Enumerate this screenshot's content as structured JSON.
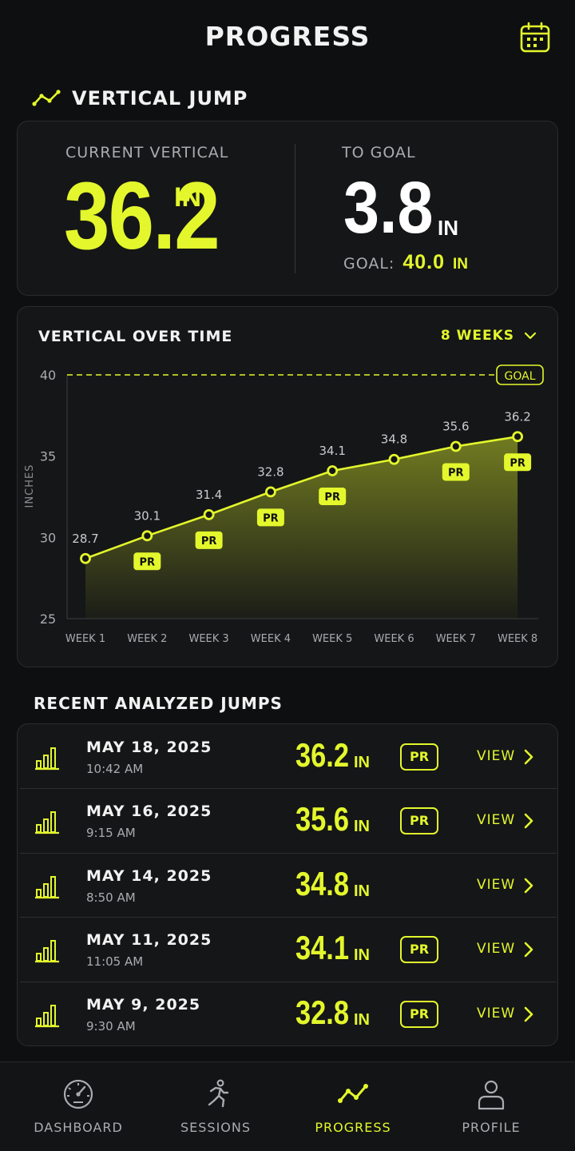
{
  "header": {
    "title": "PROGRESS"
  },
  "section": {
    "title": "VERTICAL JUMP"
  },
  "stats": {
    "current_label": "CURRENT VERTICAL",
    "current_value": "36.2",
    "current_unit": "IN",
    "to_goal_label": "TO GOAL",
    "to_goal_value": "3.8",
    "to_goal_unit": "IN",
    "goal_label": "GOAL:",
    "goal_value": "40.0",
    "goal_unit": "IN"
  },
  "chart": {
    "title": "VERTICAL OVER TIME",
    "range_label": "8 WEEKS",
    "goal_tag": "GOAL",
    "pr_label": "PR"
  },
  "chart_data": {
    "type": "line",
    "x": [
      "WEEK 1",
      "WEEK 2",
      "WEEK 3",
      "WEEK 4",
      "WEEK 5",
      "WEEK 6",
      "WEEK 7",
      "WEEK 8"
    ],
    "series": [
      {
        "values": [
          28.7,
          30.1,
          31.4,
          32.8,
          34.1,
          34.8,
          35.6,
          36.2
        ]
      }
    ],
    "pr_flags": [
      false,
      true,
      true,
      true,
      true,
      false,
      true,
      true
    ],
    "goal": 40,
    "ylabel": "INCHES",
    "xlabel": "",
    "ylim": [
      25,
      40
    ],
    "yticks": [
      25,
      30,
      35,
      40
    ],
    "area_fill": true,
    "grid": false,
    "accent": "#e3f72c"
  },
  "recent": {
    "title": "RECENT ANALYZED JUMPS",
    "view_label": "VIEW",
    "items": [
      {
        "date": "MAY 18, 2025",
        "time": "10:42 AM",
        "value": "36.2",
        "unit": "IN",
        "pr": "PR"
      },
      {
        "date": "MAY 16, 2025",
        "time": "9:15 AM",
        "value": "35.6",
        "unit": "IN",
        "pr": "PR"
      },
      {
        "date": "MAY 14, 2025",
        "time": "8:50 AM",
        "value": "34.8",
        "unit": "IN",
        "pr": ""
      },
      {
        "date": "MAY 11, 2025",
        "time": "11:05 AM",
        "value": "34.1",
        "unit": "IN",
        "pr": "PR"
      },
      {
        "date": "MAY 9, 2025",
        "time": "9:30 AM",
        "value": "32.8",
        "unit": "IN",
        "pr": "PR"
      }
    ]
  },
  "nav": {
    "items": [
      {
        "label": "DASHBOARD",
        "icon": "gauge-icon"
      },
      {
        "label": "SESSIONS",
        "icon": "runner-icon"
      },
      {
        "label": "PROGRESS",
        "icon": "trend-icon"
      },
      {
        "label": "PROFILE",
        "icon": "person-icon"
      }
    ],
    "active": "PROGRESS"
  },
  "colors": {
    "accent": "#e3f72c",
    "background": "#0e0f10",
    "card": "#151617"
  }
}
